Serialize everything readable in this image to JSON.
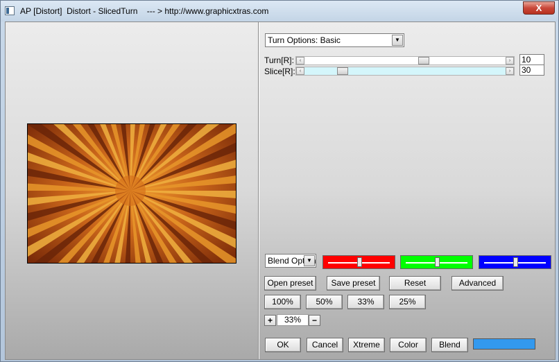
{
  "window": {
    "title": "AP [Distort]  Distort - SlicedTurn    --- > http://www.graphicxtras.com",
    "close_label": "X"
  },
  "options_select": {
    "value": "Turn Options: Basic"
  },
  "sliders": [
    {
      "label": "Turn[R]:",
      "value": "10",
      "level": 0.6,
      "track_color": "#ffffff"
    },
    {
      "label": "Slice[R]:",
      "value": "30",
      "level": 0.17,
      "track_color": "#d4f6fb"
    }
  ],
  "blend_select": {
    "value": "Blend Options"
  },
  "color_sliders": [
    {
      "name": "red",
      "color": "#ff0000",
      "level": 0.5
    },
    {
      "name": "green",
      "color": "#00ff00",
      "level": 0.5
    },
    {
      "name": "blue",
      "color": "#0000ff",
      "level": 0.5
    }
  ],
  "preset_buttons": {
    "open": "Open preset",
    "save": "Save preset",
    "reset": "Reset",
    "advanced": "Advanced"
  },
  "zoom_buttons": [
    "100%",
    "50%",
    "33%",
    "25%"
  ],
  "zoom": {
    "plus": "+",
    "value": "33%",
    "minus": "−"
  },
  "actions": {
    "ok": "OK",
    "cancel": "Cancel",
    "xtreme": "Xtreme",
    "color": "Color",
    "blend": "Blend"
  },
  "blend_color": "#3399ee",
  "scroll_arrows": {
    "left": "‹",
    "right": "›",
    "dropdown": "▼"
  }
}
